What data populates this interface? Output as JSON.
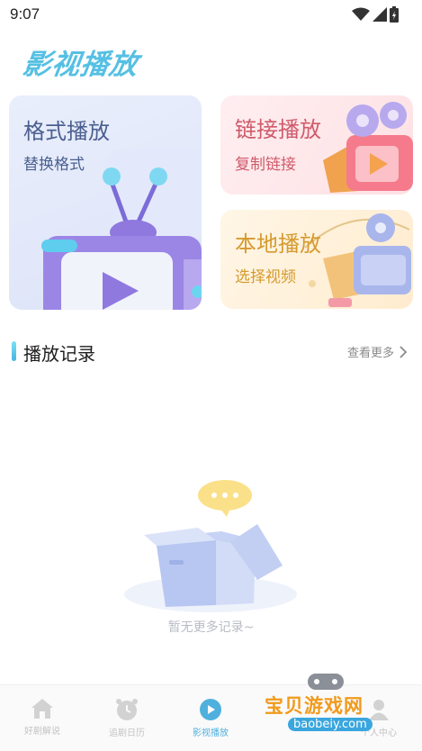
{
  "status_bar": {
    "time": "9:07"
  },
  "app": {
    "title": "影视播放"
  },
  "cards": {
    "format": {
      "title": "格式播放",
      "subtitle": "替换格式"
    },
    "link": {
      "title": "链接播放",
      "subtitle": "复制链接"
    },
    "local": {
      "title": "本地播放",
      "subtitle": "选择视频"
    }
  },
  "history": {
    "title": "播放记录",
    "more_label": "查看更多",
    "empty_text": "暂无更多记录~"
  },
  "bottom_nav": {
    "items": [
      {
        "label": "好剧解说",
        "icon": "home-icon",
        "active": false
      },
      {
        "label": "追剧日历",
        "icon": "clock-icon",
        "active": false
      },
      {
        "label": "影视播放",
        "icon": "play-icon",
        "active": true
      },
      {
        "label": "个人中心",
        "icon": "person-icon",
        "active": false
      }
    ]
  },
  "watermark": {
    "text": "宝贝游戏网",
    "url": "baobeiy.com"
  },
  "colors": {
    "accent": "#4fb0de",
    "title": "#56c0e3"
  }
}
